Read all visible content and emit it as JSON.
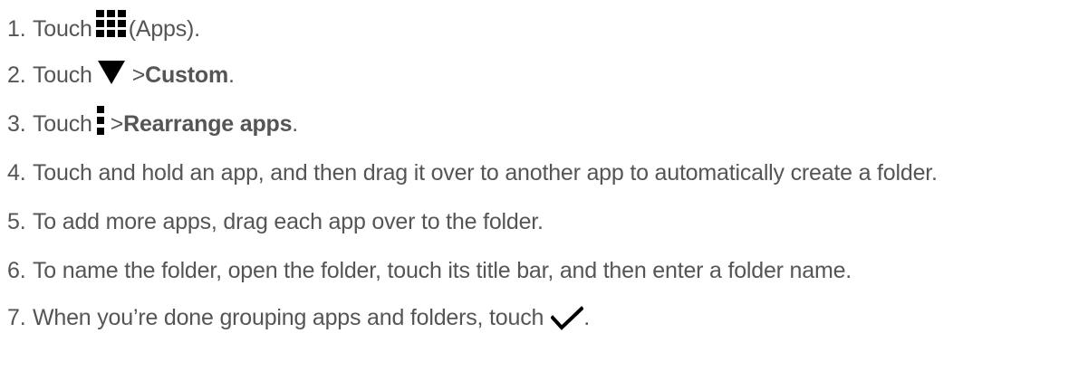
{
  "steps": [
    {
      "number": "1.",
      "parts": {
        "a": "Touch",
        "icon": "apps-grid-icon",
        "b": "(Apps)."
      }
    },
    {
      "number": "2.",
      "parts": {
        "a": "Touch",
        "icon": "down-triangle-icon",
        "b": "> ",
        "bold": "Custom",
        "c": "."
      }
    },
    {
      "number": "3.",
      "parts": {
        "a": "Touch",
        "icon": "more-vertical-icon",
        "b": "> ",
        "bold": "Rearrange apps",
        "c": "."
      }
    },
    {
      "number": "4.",
      "text": "Touch and hold an app, and then drag it over to another app to automatically create a folder."
    },
    {
      "number": "5.",
      "text": "To add more apps, drag each app over to the folder."
    },
    {
      "number": "6.",
      "text": "To name the folder, open the folder, touch its title bar, and then enter a folder name."
    },
    {
      "number": "7.",
      "parts": {
        "a": "When you’re done grouping apps and folders, touch",
        "icon": "checkmark-icon",
        "b": "."
      }
    }
  ],
  "colors": {
    "text": "#555555",
    "icon": "#000000"
  }
}
